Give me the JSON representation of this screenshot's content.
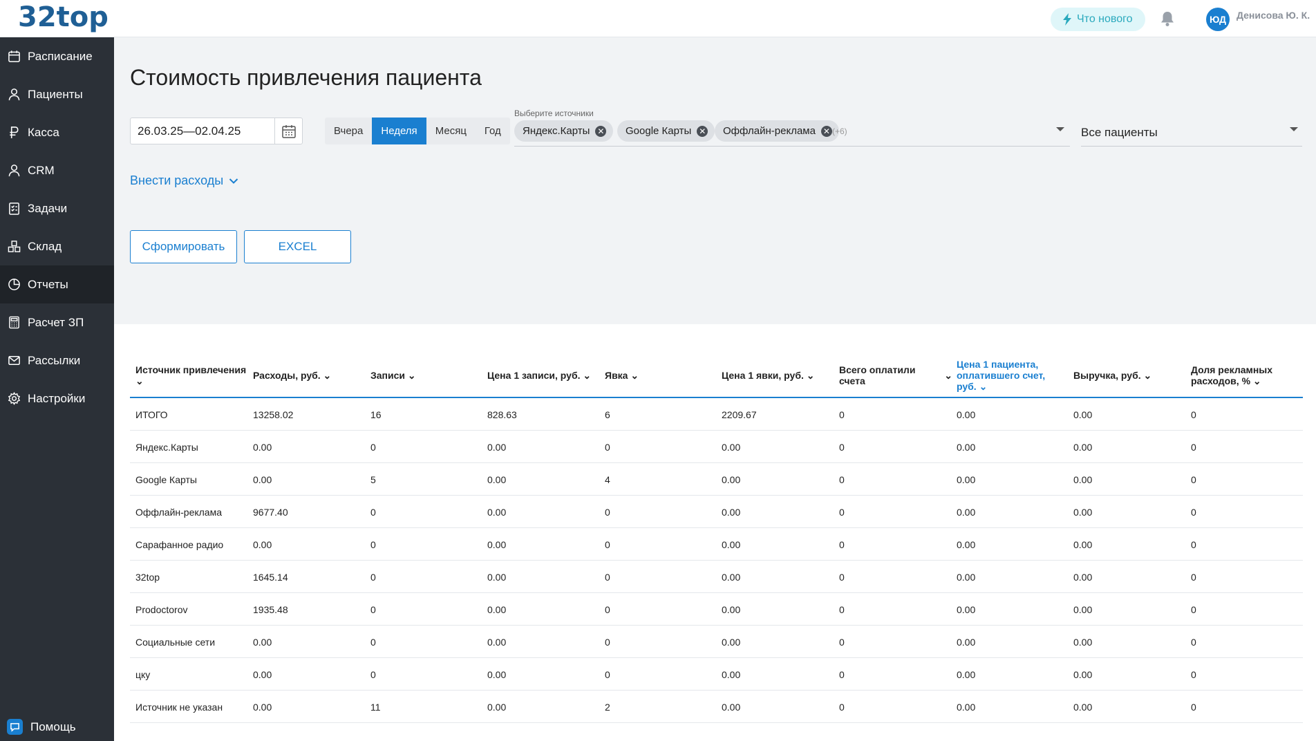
{
  "app": {
    "logo": "32top",
    "whats_new": "Что нового",
    "user_initials": "ЮД",
    "user_name": "Денисова Ю. К."
  },
  "sidebar": {
    "items": [
      {
        "label": "Расписание",
        "icon": "calendar-icon"
      },
      {
        "label": "Пациенты",
        "icon": "user-icon"
      },
      {
        "label": "Касса",
        "icon": "ruble-icon"
      },
      {
        "label": "CRM",
        "icon": "user-icon"
      },
      {
        "label": "Задачи",
        "icon": "checklist-icon"
      },
      {
        "label": "Склад",
        "icon": "boxes-icon"
      },
      {
        "label": "Отчеты",
        "icon": "pie-chart-icon",
        "active": true
      },
      {
        "label": "Расчет ЗП",
        "icon": "calculator-icon"
      },
      {
        "label": "Рассылки",
        "icon": "mail-icon"
      },
      {
        "label": "Настройки",
        "icon": "gear-icon"
      }
    ],
    "help": "Помощь"
  },
  "page": {
    "title": "Стоимость привлечения пациента",
    "date_range": "26.03.25—02.04.25",
    "periods": [
      "Вчера",
      "Неделя",
      "Месяц",
      "Год"
    ],
    "active_period": "Неделя",
    "sources_label": "Выберите источники",
    "selected_sources": [
      "Яндекс.Карты",
      "Google Карты",
      "Оффлайн-реклама"
    ],
    "more_sources": "(+6)",
    "patients_filter": "Все пациенты",
    "expenses_link": "Внести расходы",
    "generate_button": "Сформировать",
    "excel_button": "EXCEL"
  },
  "table": {
    "columns": [
      "Источник привлечения",
      "Расходы, руб.",
      "Записи",
      "Цена 1 записи, руб.",
      "Явка",
      "Цена 1 явки, руб.",
      "Всего оплатили счета",
      "Цена 1 пациента, оплатившего счет, руб.",
      "Выручка, руб.",
      "Доля рекламных расходов, %"
    ],
    "rows": [
      [
        "ИТОГО",
        "13258.02",
        "16",
        "828.63",
        "6",
        "2209.67",
        "0",
        "0.00",
        "0.00",
        "0"
      ],
      [
        "Яндекс.Карты",
        "0.00",
        "0",
        "0.00",
        "0",
        "0.00",
        "0",
        "0.00",
        "0.00",
        "0"
      ],
      [
        "Google Карты",
        "0.00",
        "5",
        "0.00",
        "4",
        "0.00",
        "0",
        "0.00",
        "0.00",
        "0"
      ],
      [
        "Оффлайн-реклама",
        "9677.40",
        "0",
        "0.00",
        "0",
        "0.00",
        "0",
        "0.00",
        "0.00",
        "0"
      ],
      [
        "Сарафанное радио",
        "0.00",
        "0",
        "0.00",
        "0",
        "0.00",
        "0",
        "0.00",
        "0.00",
        "0"
      ],
      [
        "32top",
        "1645.14",
        "0",
        "0.00",
        "0",
        "0.00",
        "0",
        "0.00",
        "0.00",
        "0"
      ],
      [
        "Prodoctorov",
        "1935.48",
        "0",
        "0.00",
        "0",
        "0.00",
        "0",
        "0.00",
        "0.00",
        "0"
      ],
      [
        "Социальные сети",
        "0.00",
        "0",
        "0.00",
        "0",
        "0.00",
        "0",
        "0.00",
        "0.00",
        "0"
      ],
      [
        "цку",
        "0.00",
        "0",
        "0.00",
        "0",
        "0.00",
        "0",
        "0.00",
        "0.00",
        "0"
      ],
      [
        "Источник не указан",
        "0.00",
        "11",
        "0.00",
        "2",
        "0.00",
        "0",
        "0.00",
        "0.00",
        "0"
      ]
    ]
  },
  "colors": {
    "accent": "#1a7fd0",
    "sidebar_bg": "#2b3037",
    "sidebar_active": "#1f2328",
    "logo": "#1f5f95",
    "whats_new_bg": "#dff6f9"
  }
}
